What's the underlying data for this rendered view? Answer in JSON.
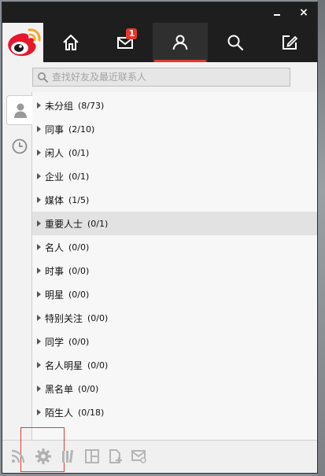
{
  "window": {
    "minimize_label": "_",
    "close_label": "×"
  },
  "nav": {
    "tabs": [
      {
        "name": "home",
        "icon": "home-icon"
      },
      {
        "name": "messages",
        "icon": "mail-icon",
        "badge": "1"
      },
      {
        "name": "contacts",
        "icon": "user-icon",
        "active": true
      },
      {
        "name": "search",
        "icon": "search-icon"
      },
      {
        "name": "compose",
        "icon": "edit-icon"
      }
    ]
  },
  "search": {
    "placeholder": "查找好友及最近联系人"
  },
  "groups": [
    {
      "name": "未分组",
      "count": "(8/73)"
    },
    {
      "name": "同事",
      "count": "(2/10)"
    },
    {
      "name": "闲人",
      "count": "(0/1)"
    },
    {
      "name": "企业",
      "count": "(0/1)"
    },
    {
      "name": "媒体",
      "count": "(1/5)"
    },
    {
      "name": "重要人士",
      "count": "(0/1)"
    },
    {
      "name": "名人",
      "count": "(0/0)"
    },
    {
      "name": "时事",
      "count": "(0/0)"
    },
    {
      "name": "明星",
      "count": "(0/0)"
    },
    {
      "name": "特别关注",
      "count": "(0/0)"
    },
    {
      "name": "同学",
      "count": "(0/0)"
    },
    {
      "name": "名人明星",
      "count": "(0/0)"
    },
    {
      "name": "黑名单",
      "count": "(0/0)"
    },
    {
      "name": "陌生人",
      "count": "(0/18)"
    }
  ],
  "colors": {
    "accent": "#e8362b",
    "titlebar": "#1e1e1e"
  }
}
